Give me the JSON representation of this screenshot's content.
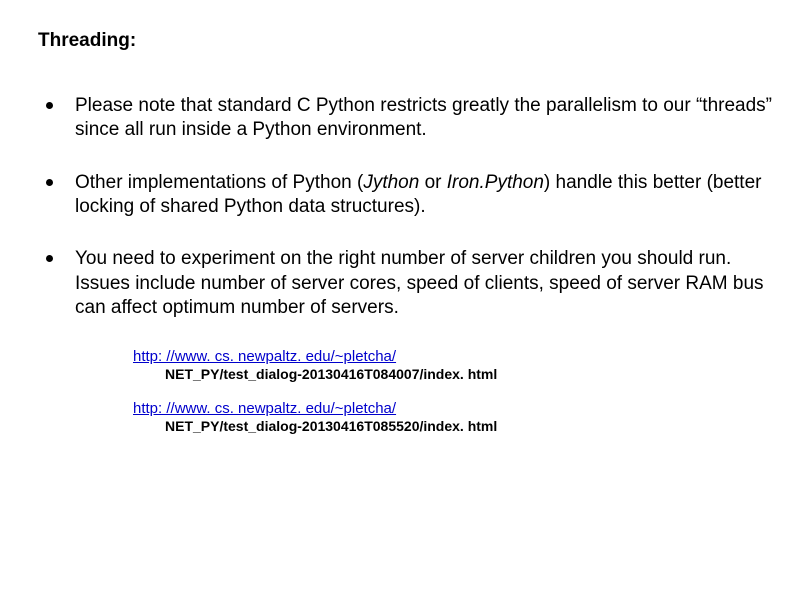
{
  "title": "Threading:",
  "bullets": [
    {
      "text": "Please note that standard C Python restricts greatly the parallelism to our “threads” since all run inside a Python environment."
    },
    {
      "prefix": "Other implementations of Python (",
      "italic1": "Jython",
      "mid": " or ",
      "italic2": "Iron.Python",
      "suffix": ") handle this better (better locking of shared Python data structures)."
    },
    {
      "text": "You need to experiment on the right number of server children you should run. Issues include number of server cores, speed of clients, speed of server RAM bus can affect optimum number of servers."
    }
  ],
  "links": [
    {
      "url": "http: //www. cs. newpaltz. edu/~pletcha/",
      "sub": "NET_PY/test_dialog-20130416T084007/index. html"
    },
    {
      "url": "http: //www. cs. newpaltz. edu/~pletcha/",
      "sub": "NET_PY/test_dialog-20130416T085520/index. html"
    }
  ]
}
